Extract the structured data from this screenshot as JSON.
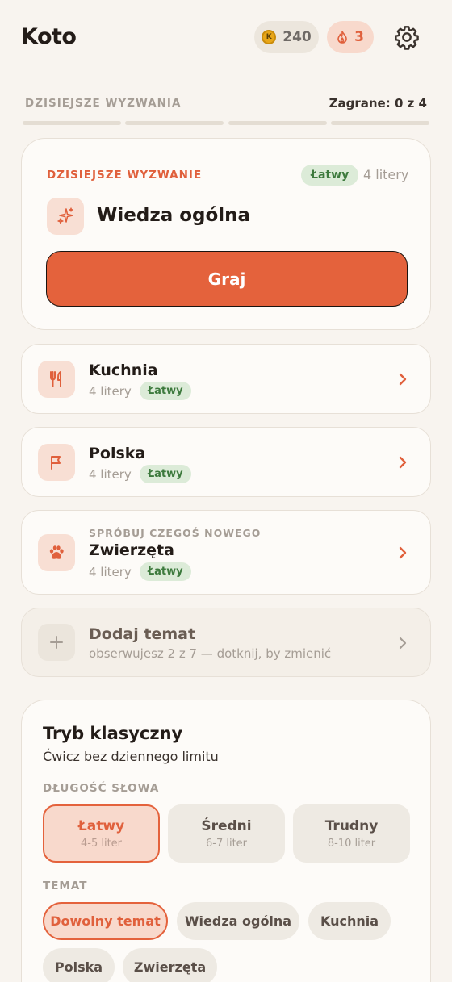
{
  "header": {
    "logo": "Koto",
    "coins": "240",
    "coin_symbol": "K",
    "streak": "3"
  },
  "challenges": {
    "section_label": "DZISIEJSZE WYZWANIA",
    "played": "Zagrane: 0 z 4"
  },
  "featured": {
    "label": "DZISIEJSZE WYZWANIE",
    "difficulty": "Łatwy",
    "letters": "4 litery",
    "title": "Wiedza ogólna",
    "play_label": "Graj"
  },
  "topics": [
    {
      "title": "Kuchnia",
      "letters": "4 litery",
      "difficulty": "Łatwy",
      "icon": "fork-knife-icon"
    },
    {
      "title": "Polska",
      "letters": "4 litery",
      "difficulty": "Łatwy",
      "icon": "flag-icon"
    },
    {
      "kicker": "SPRÓBUJ CZEGOŚ NOWEGO",
      "title": "Zwierzęta",
      "letters": "4 litery",
      "difficulty": "Łatwy",
      "icon": "paw-icon"
    }
  ],
  "add_topic": {
    "title": "Dodaj temat",
    "subtitle": "obserwujesz 2 z 7 — dotknij, by zmienić"
  },
  "classic": {
    "title": "Tryb klasyczny",
    "subtitle": "Ćwicz bez dziennego limitu",
    "length_label": "DŁUGOŚĆ SŁOWA",
    "levels": [
      {
        "title": "Łatwy",
        "range": "4-5 liter",
        "selected": true
      },
      {
        "title": "Średni",
        "range": "6-7 liter",
        "selected": false
      },
      {
        "title": "Trudny",
        "range": "8-10 liter",
        "selected": false
      }
    ],
    "topic_label": "TEMAT",
    "topics": [
      "Dowolny temat",
      "Wiedza ogólna",
      "Kuchnia",
      "Polska",
      "Zwierzęta"
    ],
    "selected_topic": "Dowolny temat"
  },
  "colors": {
    "accent": "#e4623c",
    "background": "#f8f4ef",
    "badge_green": "#3d7a3d"
  }
}
